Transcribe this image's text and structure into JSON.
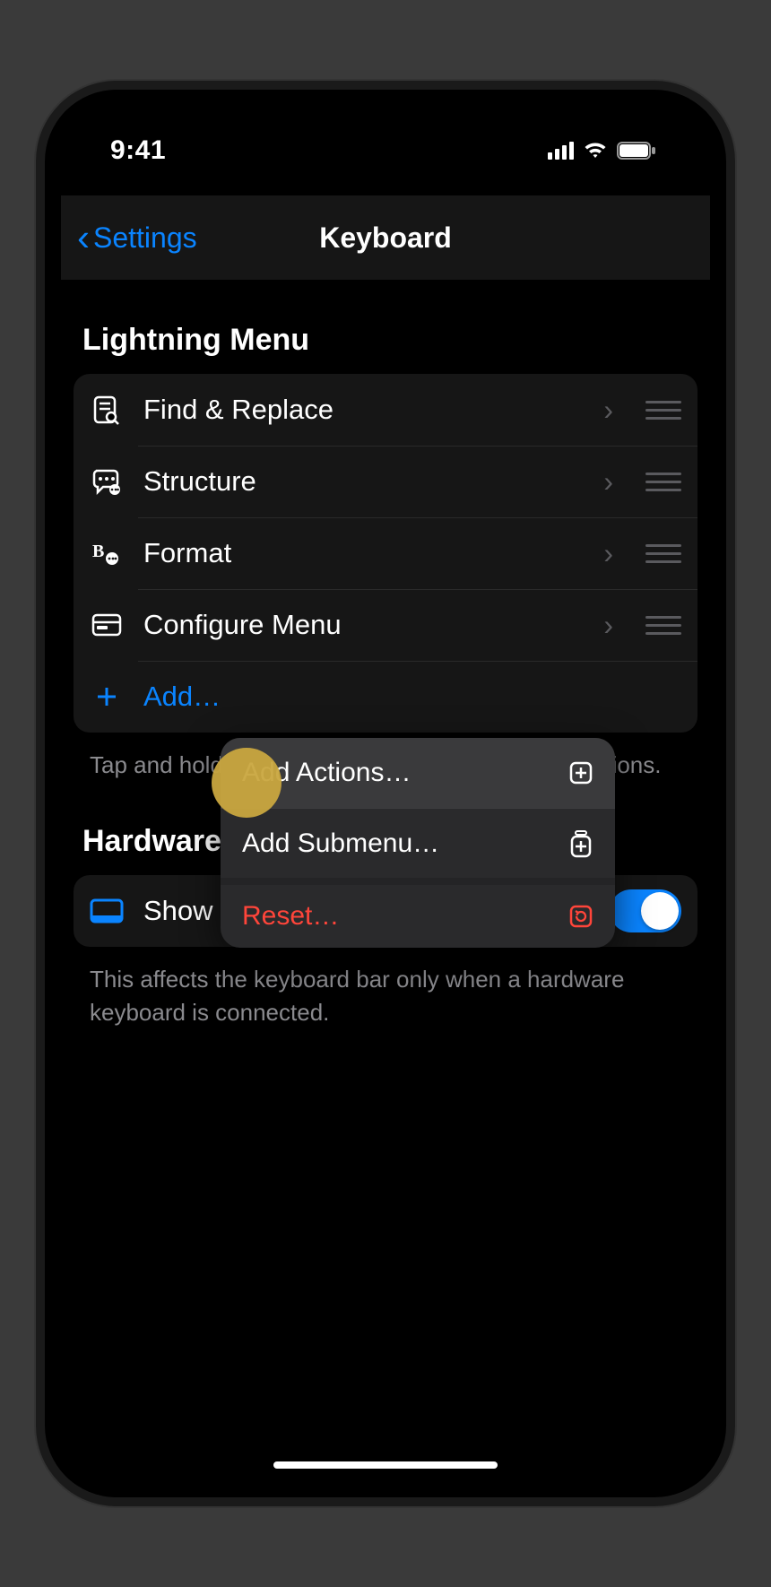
{
  "status": {
    "time": "9:41"
  },
  "nav": {
    "back": "Settings",
    "title": "Keyboard"
  },
  "lightning": {
    "header": "Lightning Menu",
    "items": [
      {
        "label": "Find & Replace"
      },
      {
        "label": "Structure"
      },
      {
        "label": "Format"
      },
      {
        "label": "Configure Menu"
      }
    ],
    "add": "Add…",
    "footer": "Tap and hold the lightning button to open these actions."
  },
  "hardware": {
    "header": "Hardware Keyboard",
    "row_label": "Show Keyboard Bar",
    "footer": "This affects the keyboard bar only when a hardware keyboard is connected."
  },
  "popover": {
    "add_actions": "Add Actions…",
    "add_submenu": "Add Submenu…",
    "reset": "Reset…"
  }
}
